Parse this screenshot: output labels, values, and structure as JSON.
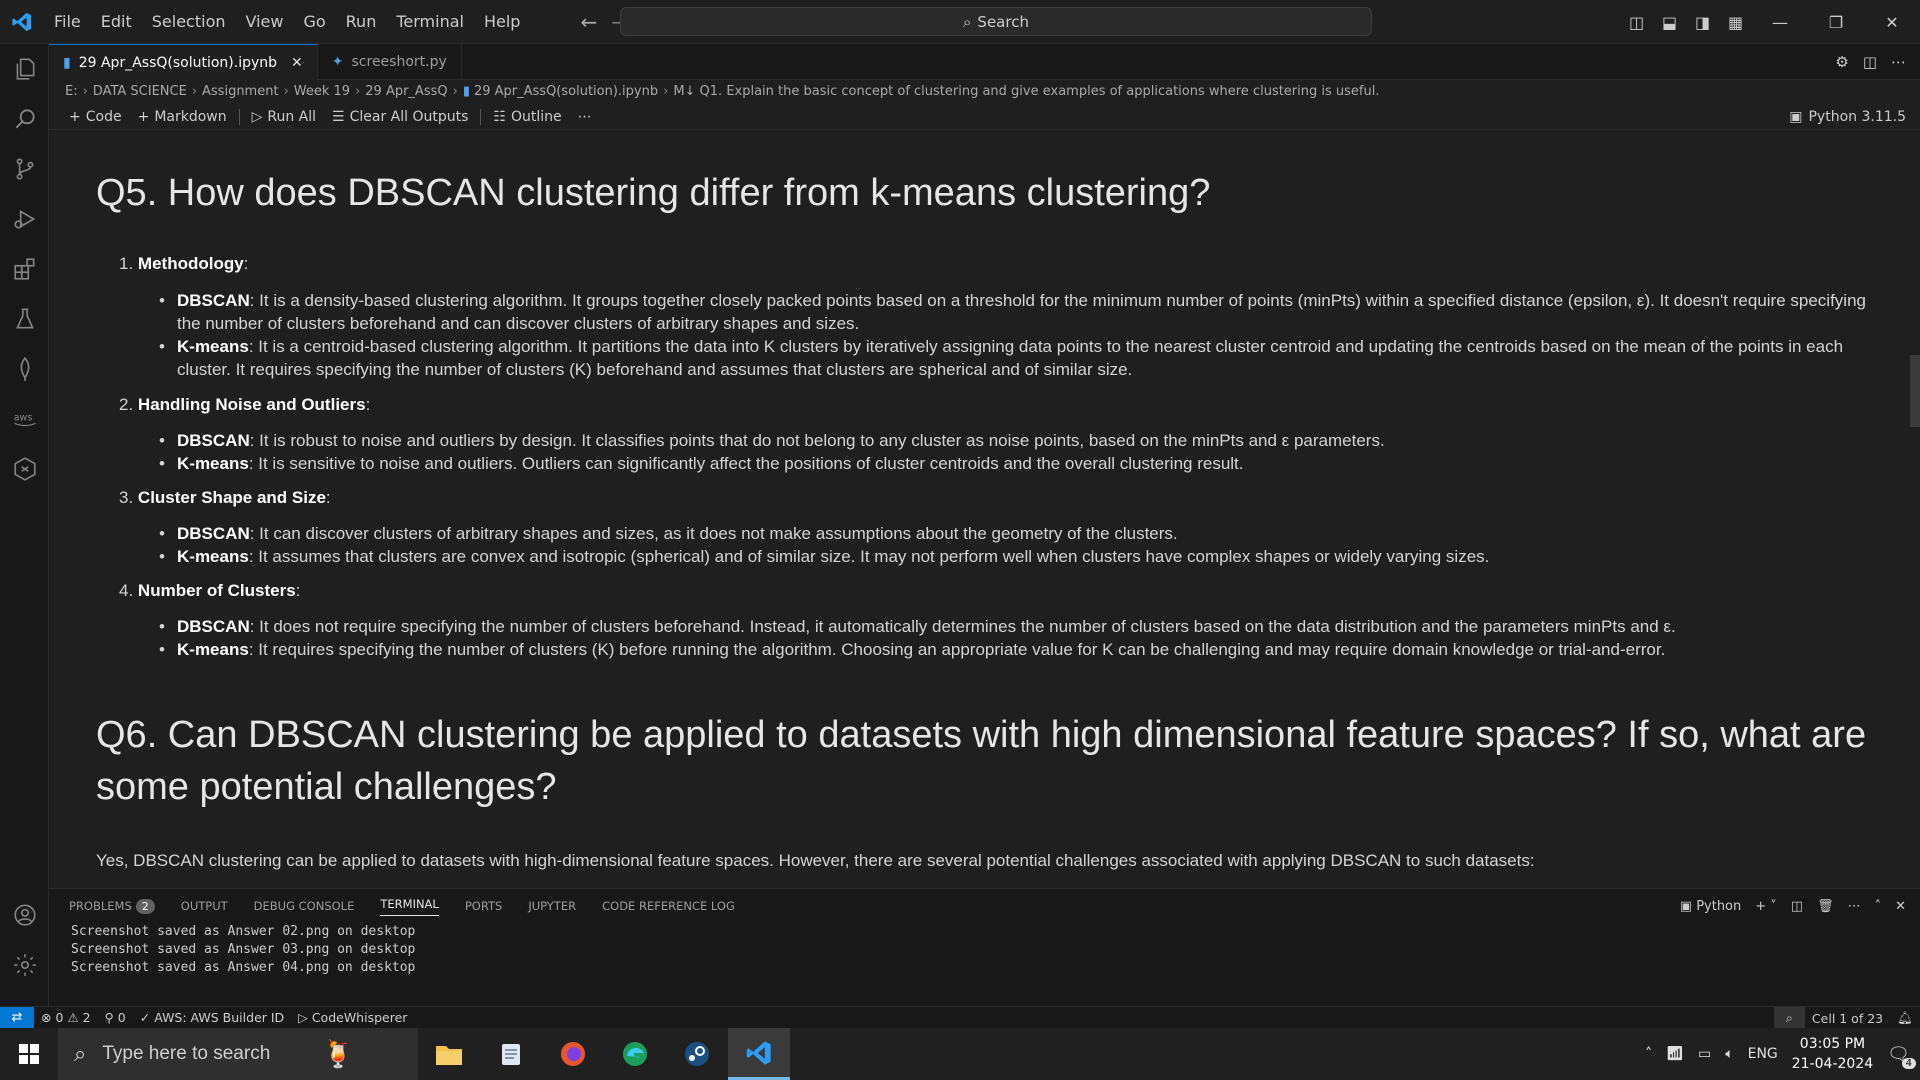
{
  "menu": [
    "File",
    "Edit",
    "Selection",
    "View",
    "Go",
    "Run",
    "Terminal",
    "Help"
  ],
  "search": {
    "label": "Search"
  },
  "tabs": [
    {
      "label": "29 Apr_AssQ(solution).ipynb",
      "active": true
    },
    {
      "label": "screeshort.py",
      "active": false
    }
  ],
  "breadcrumb": [
    "E:",
    "DATA SCIENCE",
    "Assignment",
    "Week 19",
    "29 Apr_AssQ",
    "29 Apr_AssQ(solution).ipynb",
    "M↓ Q1. Explain the basic concept of clustering and give examples of applications where clustering is useful."
  ],
  "toolbar": {
    "code": "Code",
    "markdown": "Markdown",
    "run_all": "Run All",
    "clear": "Clear All Outputs",
    "outline": "Outline",
    "kernel": "Python 3.11.5"
  },
  "content": {
    "q5_title": "Q5. How does DBSCAN clustering differ from k-means clustering?",
    "sections": [
      {
        "num": "1.",
        "title": "Methodology",
        "bullets": [
          {
            "term": "DBSCAN",
            "text": ": It is a density-based clustering algorithm. It groups together closely packed points based on a threshold for the minimum number of points (minPts) within a specified distance (epsilon, ε). It doesn't require specifying the number of clusters beforehand and can discover clusters of arbitrary shapes and sizes."
          },
          {
            "term": "K-means",
            "text": ": It is a centroid-based clustering algorithm. It partitions the data into K clusters by iteratively assigning data points to the nearest cluster centroid and updating the centroids based on the mean of the points in each cluster. It requires specifying the number of clusters (K) beforehand and assumes that clusters are spherical and of similar size."
          }
        ]
      },
      {
        "num": "2.",
        "title": "Handling Noise and Outliers",
        "bullets": [
          {
            "term": "DBSCAN",
            "text": ": It is robust to noise and outliers by design. It classifies points that do not belong to any cluster as noise points, based on the minPts and ε parameters."
          },
          {
            "term": "K-means",
            "text": ": It is sensitive to noise and outliers. Outliers can significantly affect the positions of cluster centroids and the overall clustering result."
          }
        ]
      },
      {
        "num": "3.",
        "title": "Cluster Shape and Size",
        "bullets": [
          {
            "term": "DBSCAN",
            "text": ": It can discover clusters of arbitrary shapes and sizes, as it does not make assumptions about the geometry of the clusters."
          },
          {
            "term": "K-means",
            "text": ": It assumes that clusters are convex and isotropic (spherical) and of similar size. It may not perform well when clusters have complex shapes or widely varying sizes."
          }
        ]
      },
      {
        "num": "4.",
        "title": "Number of Clusters",
        "bullets": [
          {
            "term": "DBSCAN",
            "text": ": It does not require specifying the number of clusters beforehand. Instead, it automatically determines the number of clusters based on the data distribution and the parameters minPts and ε."
          },
          {
            "term": "K-means",
            "text": ": It requires specifying the number of clusters (K) before running the algorithm. Choosing an appropriate value for K can be challenging and may require domain knowledge or trial-and-error."
          }
        ]
      }
    ],
    "q6_title": "Q6. Can DBSCAN clustering be applied to datasets with high dimensional feature spaces? If so, what are some potential challenges?",
    "q6_para": "Yes, DBSCAN clustering can be applied to datasets with high-dimensional feature spaces. However, there are several potential challenges associated with applying DBSCAN to such datasets:"
  },
  "panel": {
    "tabs": [
      "PROBLEMS",
      "OUTPUT",
      "DEBUG CONSOLE",
      "TERMINAL",
      "PORTS",
      "JUPYTER",
      "CODE REFERENCE LOG"
    ],
    "problems_count": "2",
    "active_tab": "TERMINAL",
    "shell": "Python",
    "terminal_lines": [
      "Screenshot saved as Answer 02.png on desktop",
      "Screenshot saved as Answer 03.png on desktop",
      "Screenshot saved as Answer 04.png on desktop"
    ]
  },
  "status": {
    "errors": "0",
    "warnings": "2",
    "ports": "0",
    "aws": "AWS: AWS Builder ID",
    "codewhisperer": "CodeWhisperer",
    "cell": "Cell 1 of 23"
  },
  "taskbar": {
    "search_placeholder": "Type here to search",
    "lang": "ENG",
    "time": "03:05 PM",
    "date": "21-04-2024",
    "notif_count": "4"
  },
  "colors": {
    "accent": "#0078d4",
    "bg": "#1f1f1f",
    "bar": "#181818"
  }
}
